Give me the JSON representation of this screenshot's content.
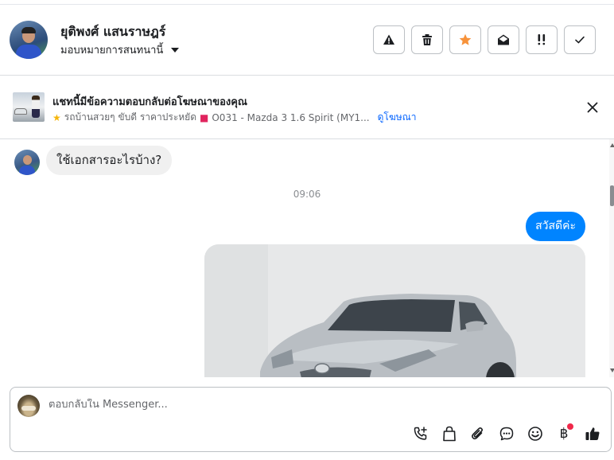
{
  "header": {
    "contact_name": "ยุติพงศ์ แสนราษฎร์",
    "assign_label": "มอบหมายการสนทนานี้",
    "actions": [
      {
        "name": "mark-spam-button",
        "icon": "warning-triangle-icon"
      },
      {
        "name": "delete-button",
        "icon": "trash-icon"
      },
      {
        "name": "star-button",
        "icon": "star-icon"
      },
      {
        "name": "mark-unread-button",
        "icon": "envelope-open-icon"
      },
      {
        "name": "follow-up-button",
        "icon": "double-exclamation-icon"
      },
      {
        "name": "mark-done-button",
        "icon": "checkmark-icon"
      }
    ],
    "star_color": "#f7923a"
  },
  "ad_banner": {
    "title": "แชทนี้มีข้อความตอบกลับต่อโฆษณาของคุณ",
    "ad_text_part1": "รถบ้านสวยๆ ขับดี ราคาประหยัด",
    "ad_text_part2": "O031 - Mazda 3 1.6 Spirit (MY1...",
    "link": "ดูโฆษณา"
  },
  "messages": {
    "incoming_text": "ใช้เอกสารอะไรบ้าง?",
    "timestamp": "09:06",
    "outgoing_text": "สวัสดีค่ะ",
    "outgoing_color": "#0084ff"
  },
  "composer": {
    "placeholder": "ตอบกลับใน Messenger...",
    "tools": [
      "add-call-icon",
      "shopping-bag-icon",
      "paperclip-icon",
      "chat-bubble-icon",
      "emoji-icon",
      "baht-icon",
      "thumbs-up-icon"
    ],
    "baht_symbol": "฿",
    "notification_color": "#f02849"
  }
}
